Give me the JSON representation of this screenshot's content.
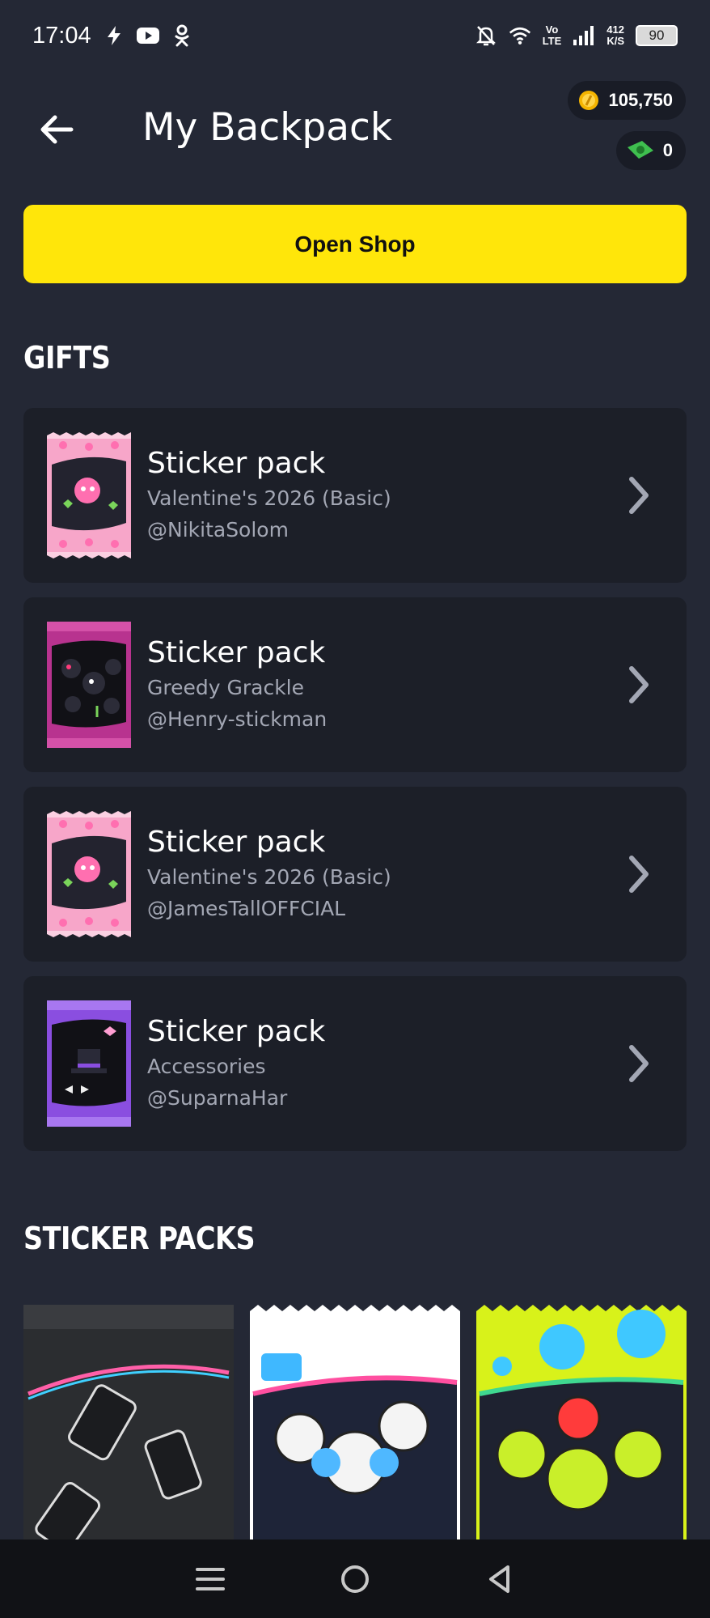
{
  "status_bar": {
    "time": "17:04",
    "net_speed_value": "412",
    "net_speed_unit": "K/S",
    "volte_top": "Vo",
    "volte_bottom": "LTE",
    "battery": "90",
    "icons": [
      "flash-icon",
      "youtube-icon",
      "ok-icon",
      "bell-off-icon",
      "wifi-icon",
      "signal-icon"
    ]
  },
  "header": {
    "title": "My Backpack",
    "coins": "105,750",
    "cash": "0"
  },
  "open_shop_label": "Open Shop",
  "sections": {
    "gifts": "GIFTS",
    "sticker_packs": "STICKER PACKS"
  },
  "gifts": [
    {
      "title": "Sticker pack",
      "subtitle": "Valentine's 2026 (Basic)",
      "from": "@NikitaSolom",
      "pack_color": "#f7a6c9"
    },
    {
      "title": "Sticker pack",
      "subtitle": "Greedy Grackle",
      "from": "@Henry-stickman",
      "pack_color": "#b8338f"
    },
    {
      "title": "Sticker pack",
      "subtitle": "Valentine's 2026 (Basic)",
      "from": "@JamesTallOFFCIAL",
      "pack_color": "#f7a6c9"
    },
    {
      "title": "Sticker pack",
      "subtitle": "Accessories",
      "from": "@SuparnaHar",
      "pack_color": "#8a4ee0"
    }
  ],
  "colors": {
    "background": "#242835",
    "card": "#1c1f28",
    "accent_yellow": "#ffe60a",
    "muted_text": "#a3a7b4"
  }
}
